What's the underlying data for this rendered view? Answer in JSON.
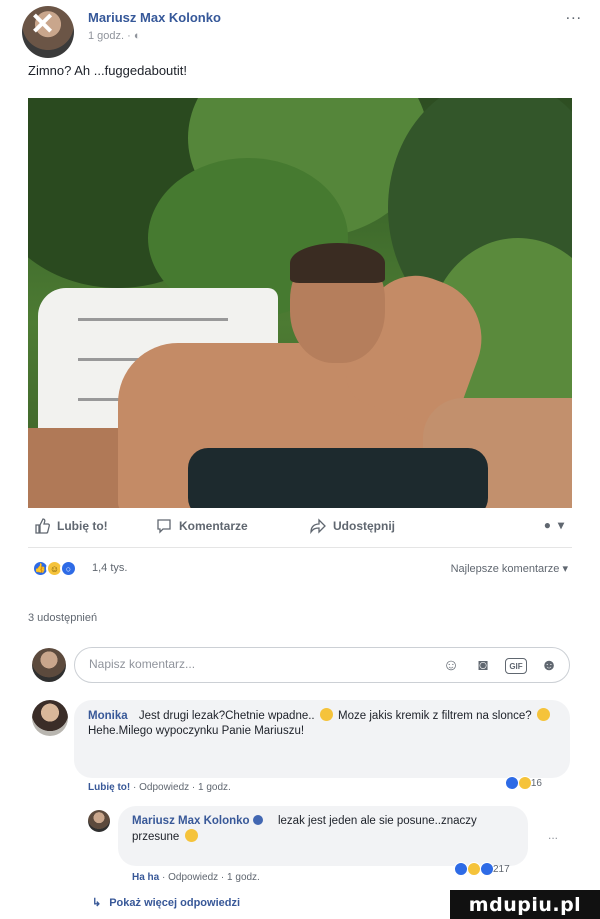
{
  "post": {
    "author": "Mariusz Max Kolonko",
    "meta": "1 godz. · ◐",
    "more": "...",
    "text": "Zimno? Ah ...fuggedaboutit!"
  },
  "actions": {
    "like": "Lubię to!",
    "comment": "Komentarze",
    "share": "Udostępnij"
  },
  "reactions": {
    "count": "1,4 tys.",
    "sort": "Najlepsze komentarze ▾"
  },
  "shares": "3 udostępnień",
  "compose": {
    "placeholder": "Napisz komentarz..."
  },
  "comments": [
    {
      "author": "Monika",
      "text_1": "Jest drugi lezak?Chetnie wpadne..",
      "text_2": "Moze jakis kremik z filtrem na slonce?",
      "text_3": "Hehe.Milego wypoczynku Panie Mariuszu!",
      "meta_like": "Lubię to!",
      "meta_rest": " · Odpowiedz · 1 godz.",
      "reactions": "16"
    },
    {
      "author": "Mariusz Max Kolonko",
      "text_1": "lezak jest jeden ale sie posune..znaczy przesune",
      "meta_like": "Ha ha",
      "meta_rest": " · Odpowiedz · 1 godz.",
      "reactions": "217",
      "more": "..."
    }
  ],
  "more_replies": "Pokaż więcej odpowiedzi",
  "watermark": "mdupiu.pl",
  "colors": {
    "link": "#385898",
    "like_blue": "#2e6be6",
    "haha_yellow": "#f5c33b"
  }
}
